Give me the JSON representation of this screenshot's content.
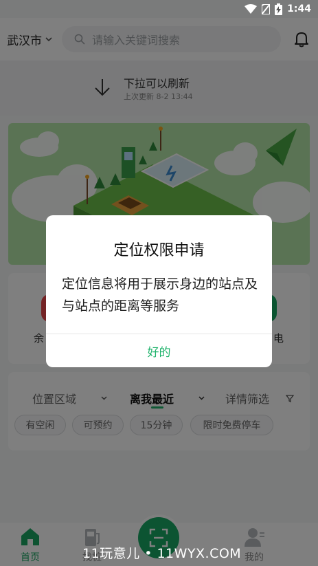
{
  "status_bar": {
    "time": "1:44"
  },
  "header": {
    "city": "武汉市",
    "search_placeholder": "请输入关键词搜索"
  },
  "refresh": {
    "title": "下拉可以刷新",
    "last_update": "上次更新 8-2 13:44"
  },
  "entries": {
    "left_label": "余",
    "right_label": "电",
    "left_icon_color": "#e8474a",
    "right_icon_color": "#17a862"
  },
  "filters": {
    "tabs": [
      {
        "label": "位置区域"
      },
      {
        "label": "离我最近"
      },
      {
        "label": "详情筛选"
      }
    ],
    "chips": [
      "有空闲",
      "可预约",
      "15分钟",
      "限时免费停车"
    ]
  },
  "bottom_nav": {
    "items": [
      {
        "label": "首页",
        "icon": "home-icon"
      },
      {
        "label": "找桩",
        "icon": "charging-pile-icon"
      },
      {
        "label": "",
        "icon": "scan-icon"
      },
      {
        "label": "我的",
        "icon": "user-icon"
      }
    ]
  },
  "dialog": {
    "title": "定位权限申请",
    "message": "定位信息将用于展示身边的站点及与站点的距离等服务",
    "ok_label": "好的"
  },
  "watermark": "11玩意儿 • 11WYX.COM",
  "colors": {
    "accent": "#1fb36b",
    "banner_bg": "#b5e6a8"
  }
}
